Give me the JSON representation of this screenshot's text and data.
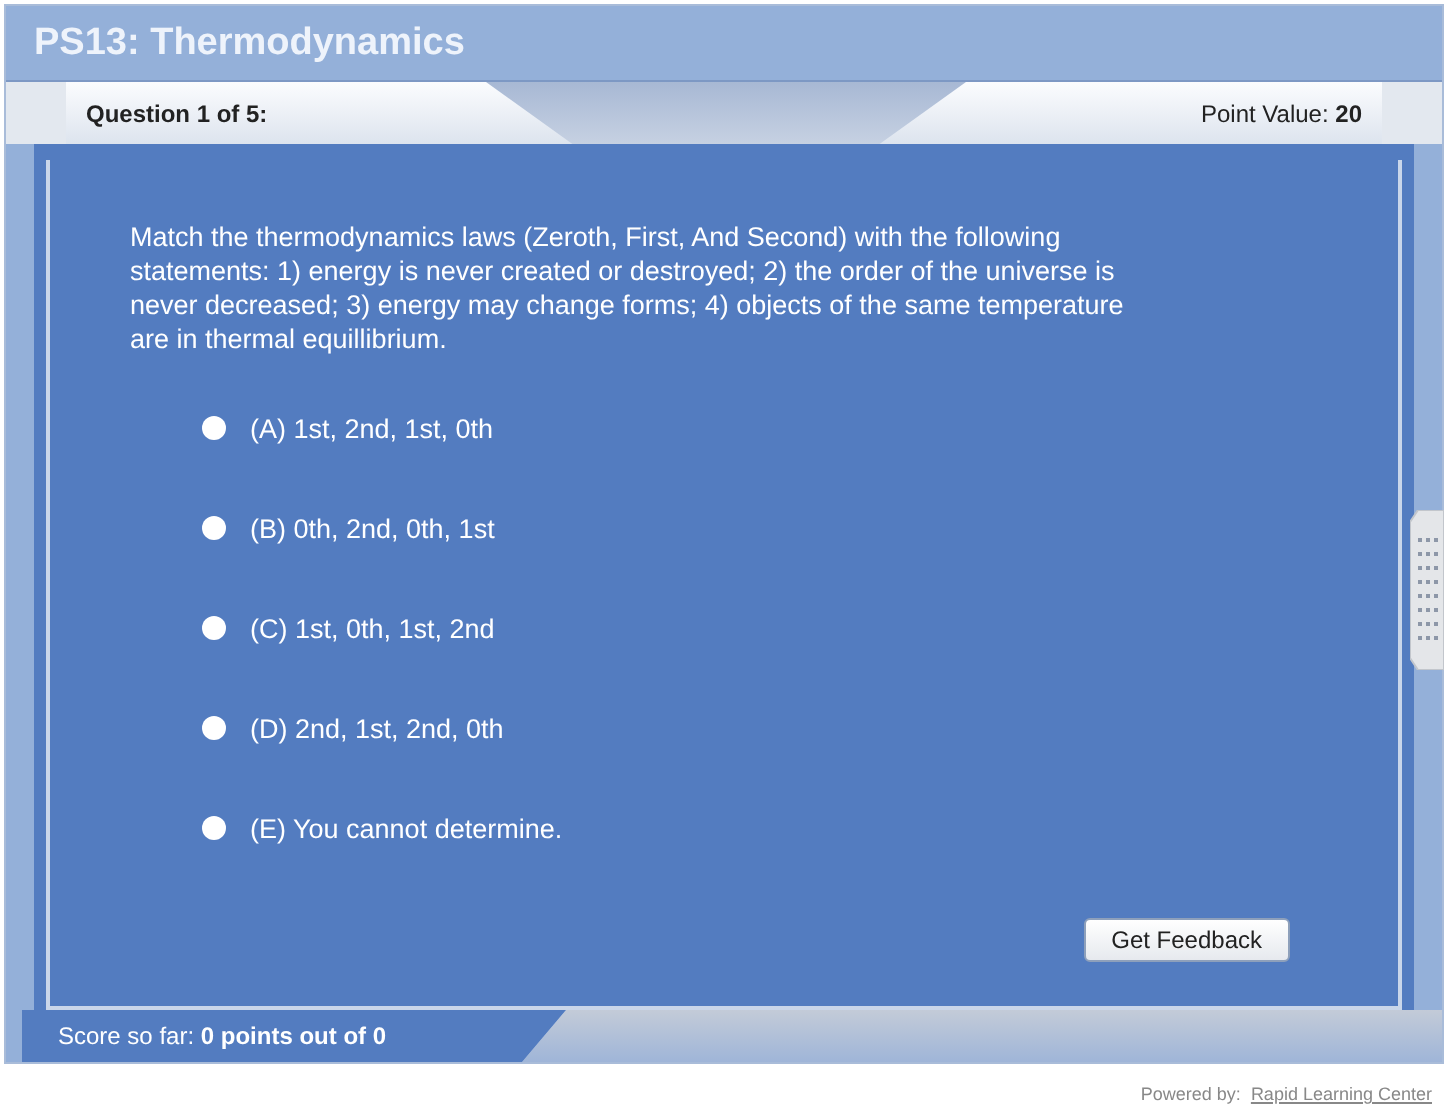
{
  "title": "PS13: Thermodynamics",
  "question_bar": {
    "counter": "Question 1 of 5:",
    "point_label": "Point Value:",
    "point_value": "20"
  },
  "question": "Match the thermodynamics laws (Zeroth, First, And Second) with the following statements: 1) energy is never created or destroyed; 2) the order of the universe is never decreased; 3) energy may change forms; 4) objects of the same temperature are in thermal equillibrium.",
  "options": [
    {
      "label": "(A) 1st, 2nd, 1st, 0th",
      "selected": false
    },
    {
      "label": "(B) 0th, 2nd, 0th, 1st",
      "selected": false
    },
    {
      "label": "(C) 1st, 0th, 1st, 2nd",
      "selected": false
    },
    {
      "label": "(D) 2nd, 1st, 2nd, 0th",
      "selected": false
    },
    {
      "label": "(E) You cannot determine.",
      "selected": false
    }
  ],
  "feedback_button": "Get Feedback",
  "score": {
    "label": "Score so far:",
    "value": "0 points out of 0"
  },
  "footer": {
    "powered_by": "Powered by:",
    "link": "Rapid Learning Center"
  }
}
